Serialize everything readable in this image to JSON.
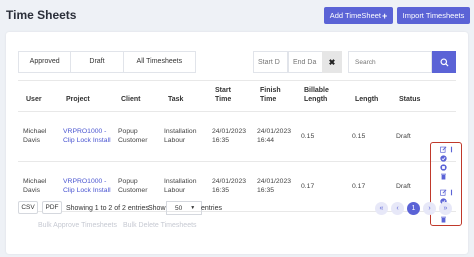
{
  "header": {
    "title": "Time Sheets",
    "add_label": "Add TimeSheet",
    "import_label": "Import Timesheets"
  },
  "filters": {
    "tabs": [
      "Approved",
      "Draft",
      "All Timesheets"
    ],
    "start_placeholder": "Start D",
    "end_placeholder": "End Da",
    "clear_label": "✖",
    "search_placeholder": "Search"
  },
  "table": {
    "columns": [
      "User",
      "Project",
      "Client",
      "Task",
      "Start Time",
      "Finish Time",
      "Billable Length",
      "Length",
      "Status"
    ],
    "rows": [
      {
        "user": "Michael Davis",
        "project": "VRPRO1000 - Clip Lock Install",
        "client": "Popup Customer",
        "task": "Installation Labour",
        "start": "24/01/2023 16:35",
        "finish": "24/01/2023 16:44",
        "billable": "0.15",
        "length": "0.15",
        "status": "Draft"
      },
      {
        "user": "Michael Davis",
        "project": "VRPRO1000 - Clip Lock Install",
        "client": "Popup Customer",
        "task": "Installation Labour",
        "start": "24/01/2023 16:35",
        "finish": "24/01/2023 16:35",
        "billable": "0.17",
        "length": "0.17",
        "status": "Draft"
      }
    ]
  },
  "footer": {
    "csv_label": "CSV",
    "pdf_label": "PDF",
    "info": "Showing 1 to 2 of 2 entries",
    "show_label": "Show",
    "page_size": "50",
    "entries_label": "entries",
    "pager": [
      "«",
      "‹",
      "1",
      "›",
      "»"
    ],
    "bulk_approve": "Bulk Approve Timesheets",
    "bulk_delete": "Bulk Delete Timesheets"
  },
  "colors": {
    "primary": "#5b63d6",
    "link": "#4a55d1",
    "highlight_border": "#c0392b"
  }
}
